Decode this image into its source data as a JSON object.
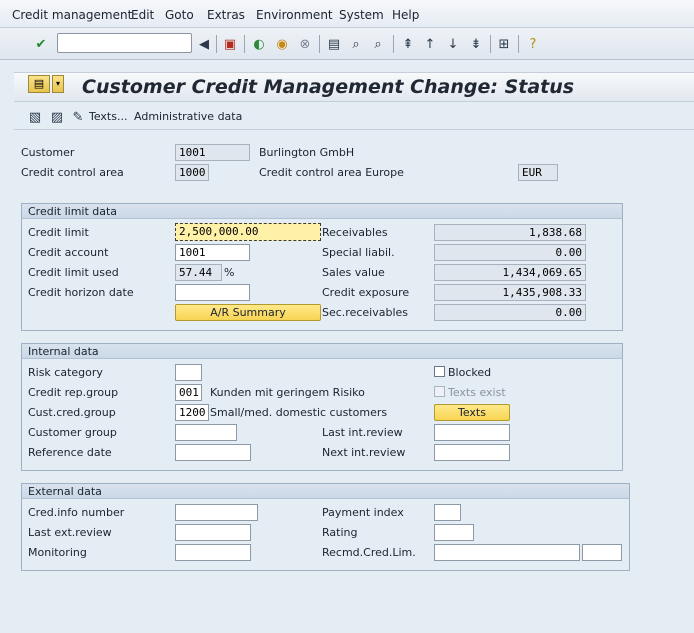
{
  "menu": [
    "Credit management",
    "Edit",
    "Goto",
    "Extras",
    "Environment",
    "System",
    "Help"
  ],
  "title": "Customer Credit Management Change: Status",
  "app_toolbar": {
    "texts": "Texts...",
    "admin": "Administrative data"
  },
  "header": {
    "customer_label": "Customer",
    "customer": "1001",
    "customer_name": "Burlington GmbH",
    "cca_label": "Credit control area",
    "cca": "1000",
    "cca_name": "Credit control area Europe",
    "currency": "EUR"
  },
  "credit_limit": {
    "title": "Credit limit data",
    "limit_label": "Credit limit",
    "limit": "2,500,000.00",
    "account_label": "Credit account",
    "account": "1001",
    "used_label": "Credit limit used",
    "used": "57.44",
    "used_unit": "%",
    "horizon_label": "Credit horizon date",
    "horizon": "",
    "ar_summary": "A/R Summary",
    "receivables_label": "Receivables",
    "receivables": "1,838.68",
    "special_label": "Special liabil.",
    "special": "0.00",
    "sales_label": "Sales value",
    "sales": "1,434,069.65",
    "exposure_label": "Credit exposure",
    "exposure": "1,435,908.33",
    "sec_label": "Sec.receivables",
    "sec": "0.00"
  },
  "internal": {
    "title": "Internal data",
    "risk_label": "Risk category",
    "risk": "",
    "rep_label": "Credit rep.group",
    "rep": "001",
    "rep_desc": "Kunden mit geringem Risiko",
    "cust_cred_label": "Cust.cred.group",
    "cust_cred": "1200",
    "cust_cred_desc": "Small/med. domestic customers",
    "cust_group_label": "Customer group",
    "cust_group": "",
    "ref_label": "Reference date",
    "ref": "",
    "blocked_label": "Blocked",
    "texts_exist_label": "Texts exist",
    "texts_btn": "Texts",
    "last_int_label": "Last int.review",
    "last_int": "",
    "next_int_label": "Next int.review",
    "next_int": ""
  },
  "external": {
    "title": "External data",
    "info_label": "Cred.info number",
    "info": "",
    "last_ext_label": "Last ext.review",
    "last_ext": "",
    "monitoring_label": "Monitoring",
    "monitoring": "",
    "payment_label": "Payment index",
    "payment": "",
    "rating_label": "Rating",
    "rating": "",
    "recmd_label": "Recmd.Cred.Lim.",
    "recmd": "",
    "recmd_cur": ""
  }
}
